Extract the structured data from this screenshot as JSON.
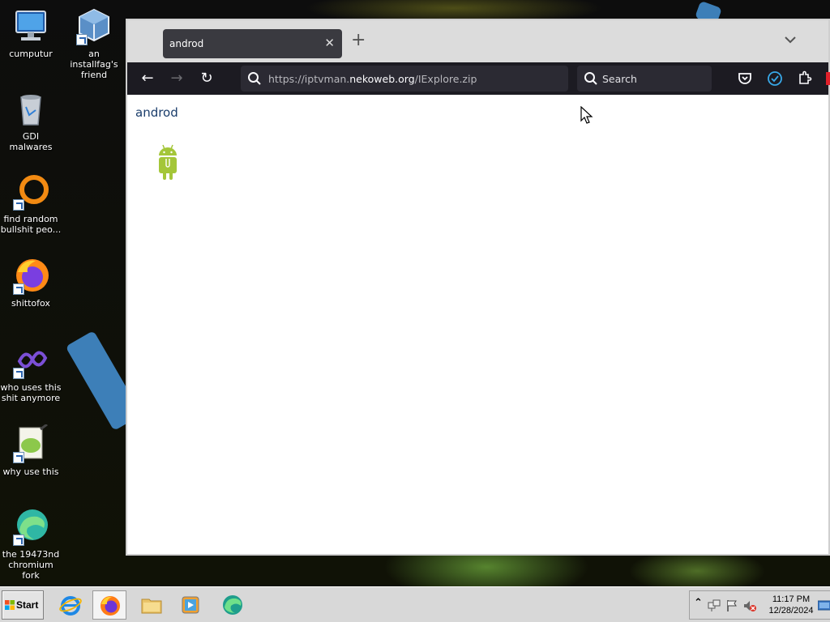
{
  "desktop": {
    "icons": [
      {
        "label": "cumputur"
      },
      {
        "label": "an installfag's friend"
      },
      {
        "label": "GDI malwares"
      },
      {
        "label": "find random bullshit peo..."
      },
      {
        "label": "shittofox"
      },
      {
        "label": "who uses this shit anymore"
      },
      {
        "label": "why use this"
      },
      {
        "label": "the 19473nd chromium fork"
      }
    ]
  },
  "browser": {
    "tab_title": "androd",
    "tab_close": "✕",
    "new_tab": "+",
    "tab_list": "⌄",
    "nav": {
      "back": "←",
      "forward": "→",
      "reload": "↻"
    },
    "url": {
      "prefix": "https://iptvman.",
      "host": "nekoweb.org",
      "path": "/IExplore.zip"
    },
    "search_placeholder": "Search",
    "page": {
      "heading": "androd"
    }
  },
  "taskbar": {
    "start_label": "Start",
    "apps": [
      "internet-explorer",
      "firefox",
      "file-explorer",
      "media-player",
      "browser-fork"
    ],
    "tray_expand": "⌃",
    "clock": {
      "time": "11:17 PM",
      "date": "12/28/2024"
    }
  }
}
